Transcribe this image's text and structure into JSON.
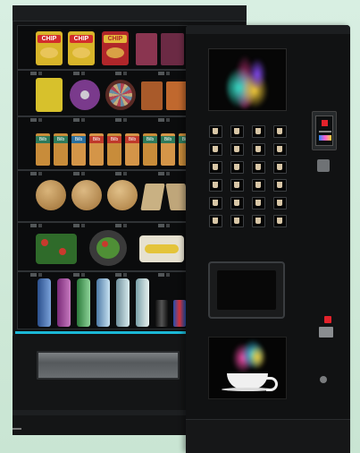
{
  "scene": {
    "description_visible_text": {
      "chip_brand": "CHIP",
      "bar_brand": "Bilb"
    }
  },
  "colors": {
    "background": "#d0ead9",
    "accent_strip": "#1bb8d6",
    "chip_bag": "#d8b52a",
    "chip_label": "#d32d2b",
    "coffee_logo": "#e2222b"
  },
  "snack_machine": {
    "shelves": [
      {
        "name": "chips",
        "items": 6
      },
      {
        "name": "mixed-snacks",
        "items": 6
      },
      {
        "name": "bars",
        "items": 9
      },
      {
        "name": "sandwiches-rolls",
        "items": 5
      },
      {
        "name": "salads-fruit",
        "items": 3
      },
      {
        "name": "drinks",
        "items": 7
      }
    ]
  },
  "coffee_machine": {
    "button_rows": 6,
    "button_cols": 4
  }
}
